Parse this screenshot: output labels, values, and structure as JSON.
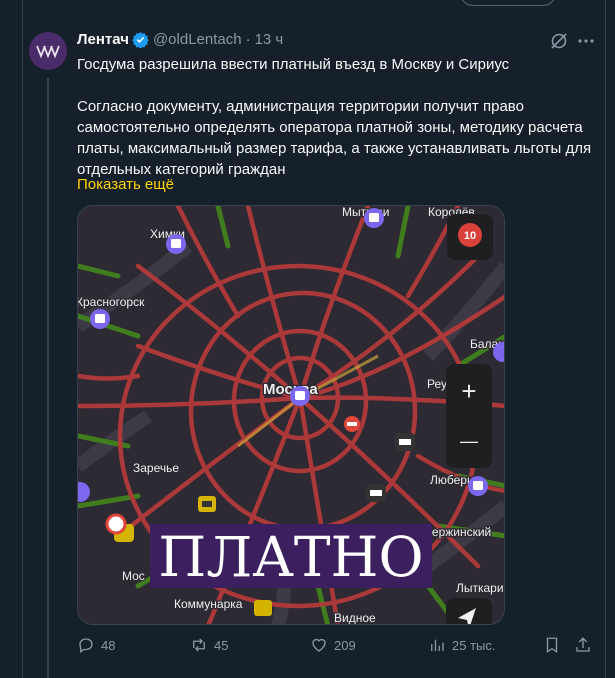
{
  "tweet": {
    "display_name": "Лентач",
    "handle": "@oldLentach",
    "separator": "·",
    "time": "13 ч",
    "title": "Госдума разрешила ввести платный въезд в Москву и Сириус",
    "body": "Согласно документу, администрация территории получит право самостоятельно определять оператора платной зоны, методику расчета платы, максимальный размер тарифа, а также устанавливать льготы для отдельных категорий граждан",
    "show_more": "Показать ещё"
  },
  "map": {
    "overlay_text": "ПЛАТНО",
    "traffic_score": "10",
    "zoom_in": "+",
    "zoom_out": "—",
    "labels": [
      "Химки",
      "Мытищи",
      "Королёв",
      "Красногорск",
      "Москва",
      "Заречье",
      "Балаш",
      "Реутов",
      "Люберцы",
      "Дзержинский",
      "Лыткарино",
      "Коммунарка",
      "Видное",
      "Мос"
    ],
    "colors": {
      "traffic_red": "#b33a3a",
      "traffic_green": "#3f7d1e",
      "map_bg": "#2d2a33",
      "overlay_bg": "#3b1f5e"
    }
  },
  "actions": {
    "replies": "48",
    "retweets": "45",
    "likes": "209",
    "views": "25 тыс."
  },
  "icons": {
    "verified": "verified-badge-icon",
    "grok": "grok-icon",
    "more": "more-icon",
    "reply": "reply-icon",
    "retweet": "retweet-icon",
    "like": "heart-icon",
    "views": "views-icon",
    "bookmark": "bookmark-icon",
    "share": "share-icon"
  }
}
